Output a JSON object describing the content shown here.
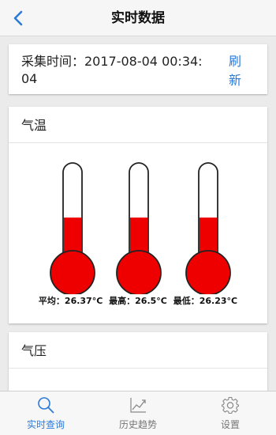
{
  "navbar": {
    "title": "实时数据"
  },
  "collection": {
    "time_text": "采集时间：2017-08-04 00:34:04",
    "refresh_label": "刷新"
  },
  "temperature": {
    "title": "气温",
    "thermometers": [
      {
        "name": "平均",
        "value": "26.37°C",
        "fill_level": 0.55
      },
      {
        "name": "最高",
        "value": "26.5°C",
        "fill_level": 0.55
      },
      {
        "name": "最低",
        "value": "26.23°C",
        "fill_level": 0.55
      }
    ],
    "labels": {
      "avg": "平均：",
      "avg_value": "26.37°C",
      "max": "最高：",
      "max_value": "26.5°C",
      "min": "最低：",
      "min_value": "26.23°C"
    },
    "fill_color": "#ee0000"
  },
  "pressure": {
    "title": "气压"
  },
  "tabs": [
    {
      "label": "实时查询",
      "icon": "search-icon",
      "active": true
    },
    {
      "label": "历史趋势",
      "icon": "trend-chart-icon",
      "active": false
    },
    {
      "label": "设置",
      "icon": "gear-icon",
      "active": false
    }
  ],
  "colors": {
    "accent": "#2b7ad8",
    "thermo_fill": "#ee0000"
  }
}
